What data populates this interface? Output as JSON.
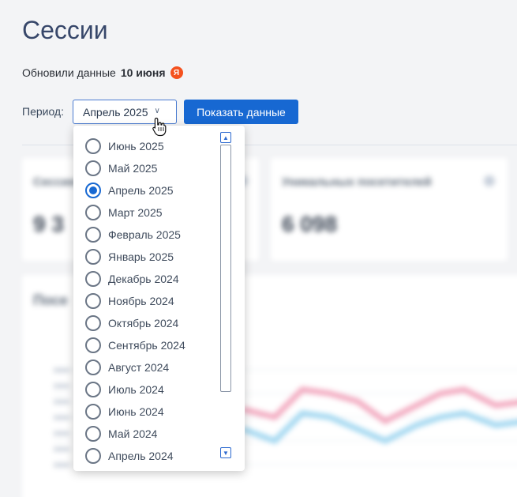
{
  "page": {
    "title": "Сессии",
    "updated_prefix": "Обновили данные",
    "updated_date": "10 июня",
    "yandex_icon_letter": "Я"
  },
  "filters": {
    "period_label": "Период:",
    "period_value": "Апрель 2025",
    "show_button_label": "Показать данные"
  },
  "dropdown": {
    "options": [
      {
        "label": "Июнь 2025",
        "checked": false
      },
      {
        "label": "Май 2025",
        "checked": false
      },
      {
        "label": "Апрель 2025",
        "checked": true
      },
      {
        "label": "Март 2025",
        "checked": false
      },
      {
        "label": "Февраль 2025",
        "checked": false
      },
      {
        "label": "Январь 2025",
        "checked": false
      },
      {
        "label": "Декабрь 2024",
        "checked": false
      },
      {
        "label": "Ноябрь 2024",
        "checked": false
      },
      {
        "label": "Октябрь 2024",
        "checked": false
      },
      {
        "label": "Сентябрь 2024",
        "checked": false
      },
      {
        "label": "Август 2024",
        "checked": false
      },
      {
        "label": "Июль 2024",
        "checked": false
      },
      {
        "label": "Июнь 2024",
        "checked": false
      },
      {
        "label": "Май 2024",
        "checked": false
      },
      {
        "label": "Апрель 2024",
        "checked": false
      }
    ]
  },
  "background_cards": {
    "sessions_title": "Сессии",
    "sessions_value": "9 3",
    "unique_users_title": "Уникальных посетителей",
    "unique_users_value": "6 098",
    "chart_title": "Посе"
  },
  "colors": {
    "accent": "#1768d2",
    "title": "#37476a",
    "yandex": "#f4511e"
  }
}
